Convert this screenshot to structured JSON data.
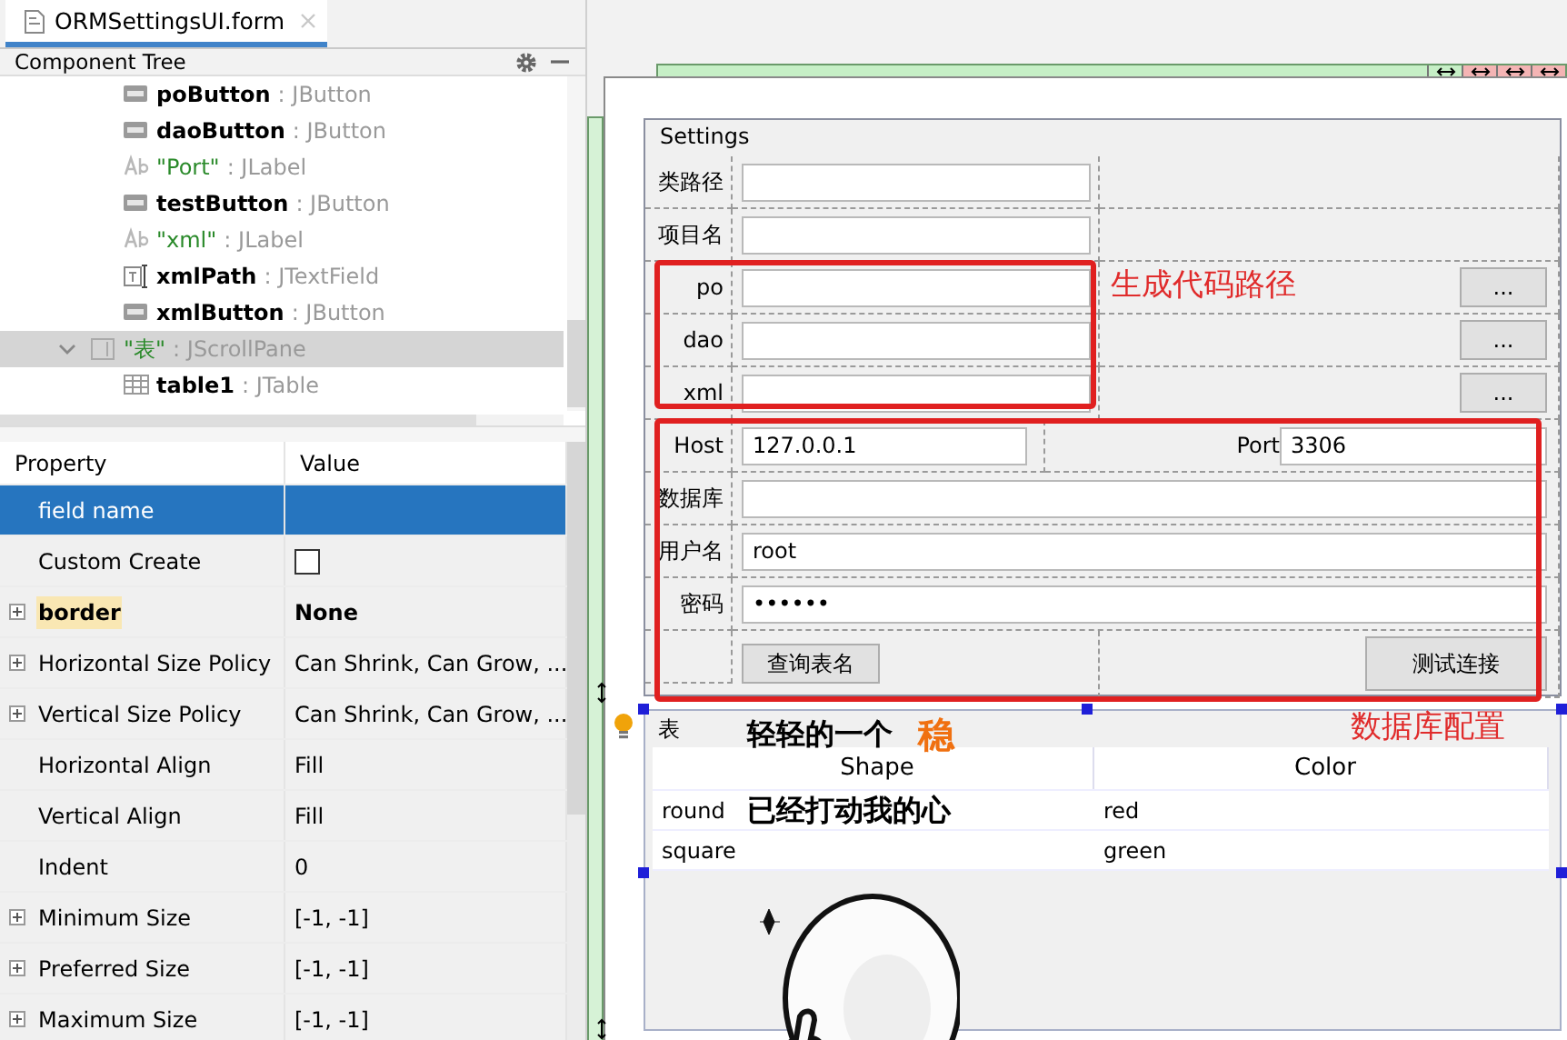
{
  "editor_tab": {
    "title": "ORMSettingsUI.form",
    "selected": true
  },
  "component_tree": {
    "title": "Component Tree",
    "items": [
      {
        "children": [
          {
            "name": "poButton",
            "type": ": JButton",
            "kind": "button",
            "bound": true,
            "selected": false
          },
          {
            "name": "daoButton",
            "type": ": JButton",
            "kind": "button",
            "bound": true,
            "selected": false
          },
          {
            "name": "\"Port\"",
            "type": ": JLabel",
            "kind": "label",
            "bound": false,
            "selected": false
          },
          {
            "name": "testButton",
            "type": ": JButton",
            "kind": "button",
            "bound": true,
            "selected": false
          },
          {
            "name": "\"xml\"",
            "type": ": JLabel",
            "kind": "label",
            "bound": false,
            "selected": false
          },
          {
            "name": "xmlPath",
            "type": ": JTextField",
            "kind": "textfield",
            "bound": true,
            "selected": false
          },
          {
            "name": "xmlButton",
            "type": ": JButton",
            "kind": "button",
            "bound": true,
            "selected": false
          }
        ]
      },
      {
        "name": "\"表\"",
        "type": ": JScrollPane",
        "kind": "scrollpane",
        "bound": false,
        "selected": true,
        "expanded": true,
        "children": [
          {
            "name": "table1",
            "type": ": JTable",
            "kind": "table",
            "bound": true,
            "selected": false
          }
        ]
      }
    ]
  },
  "properties": {
    "columns": [
      "Property",
      "Value"
    ],
    "rows": [
      {
        "name": "field name",
        "selected": true,
        "expandable": false,
        "modified": false
      },
      {
        "name": "Custom Create",
        "kind": "checkbox",
        "checked": false,
        "selected": false,
        "expandable": false,
        "modified": false
      },
      {
        "name": "border",
        "value": "None",
        "selected": false,
        "expandable": true,
        "modified": true
      },
      {
        "name": "Horizontal Size Policy",
        "value": "Can Shrink, Can Grow, ...",
        "selected": false,
        "expandable": true,
        "modified": false
      },
      {
        "name": "Vertical Size Policy",
        "value": "Can Shrink, Can Grow, ...",
        "selected": false,
        "expandable": true,
        "modified": false
      },
      {
        "name": "Horizontal Align",
        "value": "Fill",
        "selected": false,
        "expandable": false,
        "modified": false
      },
      {
        "name": "Vertical Align",
        "value": "Fill",
        "selected": false,
        "expandable": false,
        "modified": false
      },
      {
        "name": "Indent",
        "value": "0",
        "selected": false,
        "expandable": false,
        "modified": false
      },
      {
        "name": "Minimum Size",
        "value": "[-1, -1]",
        "selected": false,
        "expandable": true,
        "modified": false
      },
      {
        "name": "Preferred Size",
        "value": "[-1, -1]",
        "selected": false,
        "expandable": true,
        "modified": false
      },
      {
        "name": "Maximum Size",
        "value": "[-1, -1]",
        "selected": false,
        "expandable": true,
        "modified": false
      }
    ]
  },
  "settings": {
    "title": "Settings",
    "rows": [
      {
        "kind": "path",
        "label": "类路径"
      },
      {
        "kind": "path",
        "label": "项目名"
      },
      {
        "kind": "browse",
        "label": "po",
        "button": "..."
      },
      {
        "kind": "browse",
        "label": "dao",
        "button": "..."
      },
      {
        "kind": "browse",
        "label": "xml",
        "button": "..."
      },
      {
        "kind": "host",
        "label": "Host",
        "value": "127.0.0.1",
        "port_label": "Port",
        "port_value": "3306"
      },
      {
        "kind": "wide",
        "label": "数据库"
      },
      {
        "kind": "wide",
        "label": "用户名",
        "value": "root"
      },
      {
        "kind": "wide",
        "label": "密码",
        "value": "••••••"
      },
      {
        "kind": "actions",
        "left_button": "查询表名",
        "right_button": "测试连接"
      }
    ]
  },
  "annotations": [
    {
      "kind": "paths",
      "text": "生成代码路径"
    },
    {
      "kind": "database",
      "text": "数据库配置"
    }
  ],
  "table_panel": {
    "title": "表",
    "columns": [
      "Shape",
      "Color"
    ],
    "rows": [
      [
        "round",
        "red"
      ],
      [
        "square",
        "green"
      ]
    ]
  },
  "sticker": {
    "kind": "picture",
    "caption_line_1": "轻轻的一个",
    "highlight": "稳",
    "caption_line_2": "已经打动我的心"
  }
}
